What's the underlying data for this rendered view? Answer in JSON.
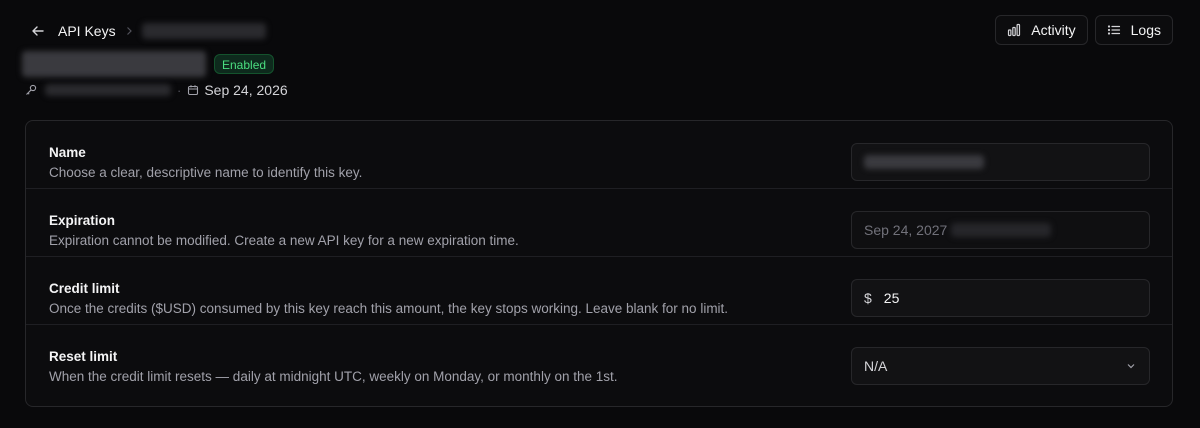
{
  "breadcrumb": {
    "parent_label": "API Keys"
  },
  "status_badge": "Enabled",
  "meta": {
    "expiry_date": "Sep 24, 2026",
    "separator": "·"
  },
  "actions": {
    "activity_label": "Activity",
    "logs_label": "Logs"
  },
  "settings": {
    "name": {
      "title": "Name",
      "description": "Choose a clear, descriptive name to identify this key."
    },
    "expiration": {
      "title": "Expiration",
      "description": "Expiration cannot be modified. Create a new API key for a new expiration time.",
      "value": "Sep 24, 2027"
    },
    "credit_limit": {
      "title": "Credit limit",
      "description": "Once the credits ($USD) consumed by this key reach this amount, the key stops working. Leave blank for no limit.",
      "currency": "$",
      "value": "25"
    },
    "reset_limit": {
      "title": "Reset limit",
      "description": "When the credit limit resets — daily at midnight UTC, weekly on Monday, or monthly on the 1st.",
      "value": "N/A"
    }
  },
  "colors": {
    "background": "#09090b",
    "badge_text": "#4ade80",
    "badge_bg": "#0e2a1d"
  }
}
